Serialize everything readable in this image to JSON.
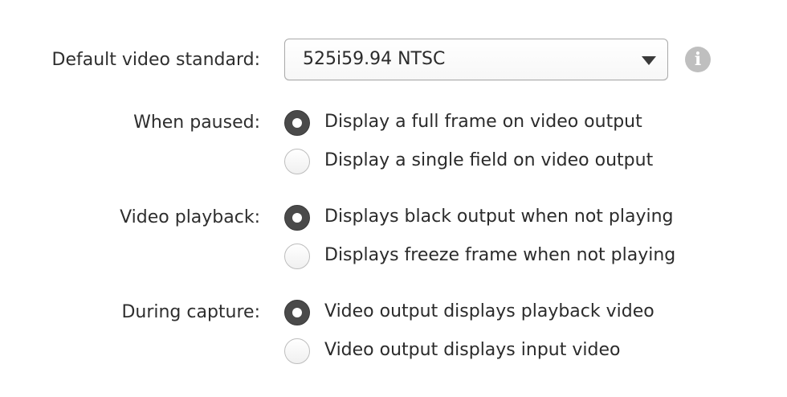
{
  "video_standard": {
    "label": "Default video standard:",
    "selected": "525i59.94 NTSC",
    "info_icon": "info-icon"
  },
  "when_paused": {
    "label": "When paused:",
    "options": [
      {
        "text": "Display a full frame on video output",
        "selected": true
      },
      {
        "text": "Display a single field on video output",
        "selected": false
      }
    ]
  },
  "video_playback": {
    "label": "Video playback:",
    "options": [
      {
        "text": "Displays black output when not playing",
        "selected": true
      },
      {
        "text": "Displays freeze frame when not playing",
        "selected": false
      }
    ]
  },
  "during_capture": {
    "label": "During capture:",
    "options": [
      {
        "text": "Video output displays playback video",
        "selected": true
      },
      {
        "text": "Video output displays input video",
        "selected": false
      }
    ]
  }
}
